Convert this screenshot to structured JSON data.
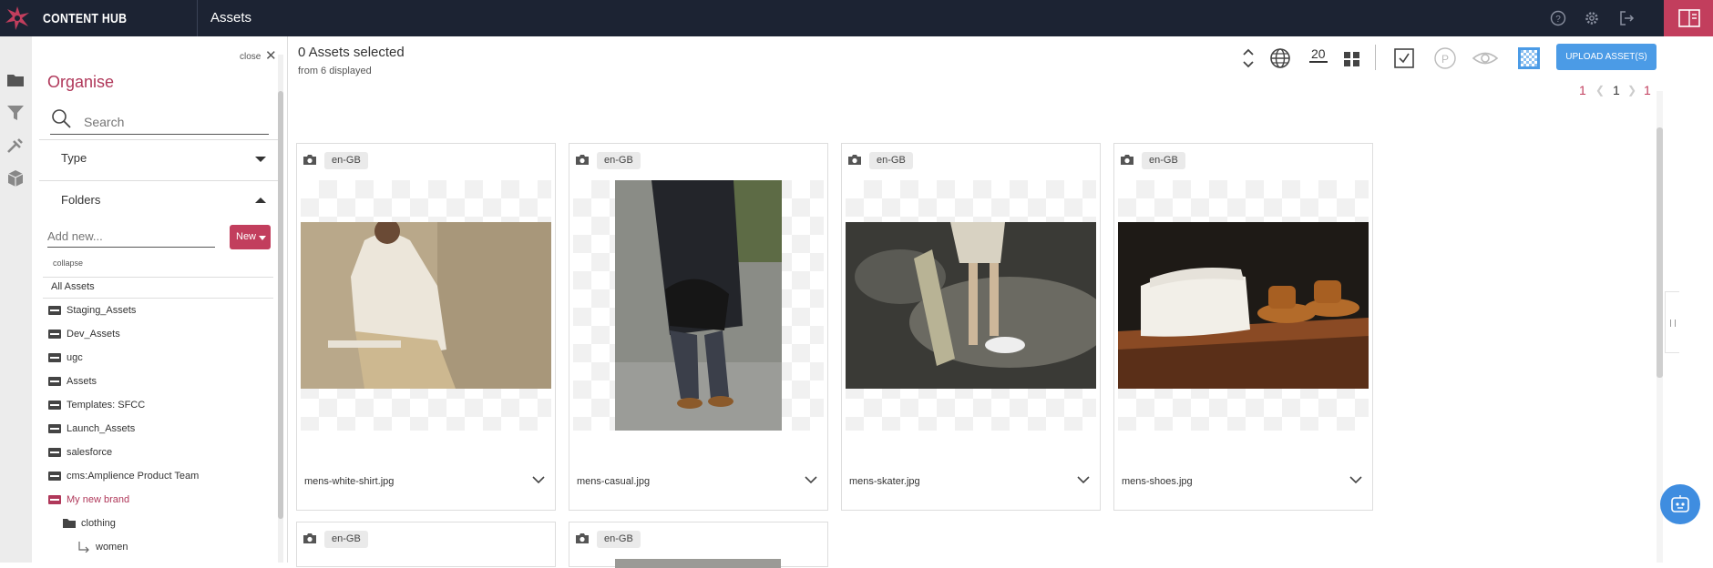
{
  "header": {
    "brand": "CONTENT HUB",
    "title": "Assets",
    "icons": [
      "help-icon",
      "settings-icon",
      "logout-icon",
      "panel-toggle-icon"
    ],
    "accent_color": "#c23e5d",
    "bg_color": "#1c2333"
  },
  "rail": {
    "icons": [
      "folder-icon",
      "filter-icon",
      "tools-icon",
      "package-icon"
    ]
  },
  "organise": {
    "close_label": "close",
    "title": "Organise",
    "search_placeholder": "Search",
    "type_label": "Type",
    "folders_label": "Folders",
    "add_new_placeholder": "Add new...",
    "new_button": "New",
    "collapse_label": "collapse",
    "all_assets": "All Assets",
    "folders": [
      {
        "label": "Staging_Assets",
        "active": false
      },
      {
        "label": "Dev_Assets",
        "active": false
      },
      {
        "label": "ugc",
        "active": false
      },
      {
        "label": "Assets",
        "active": false
      },
      {
        "label": "Templates: SFCC",
        "active": false
      },
      {
        "label": "Launch_Assets",
        "active": false
      },
      {
        "label": "salesforce",
        "active": false
      },
      {
        "label": "cms:Amplience Product Team",
        "active": false
      },
      {
        "label": "My new brand",
        "active": true
      },
      {
        "label": "clothing",
        "active": false
      },
      {
        "label": "women",
        "active": false
      }
    ]
  },
  "main": {
    "selected_title": "0 Assets selected",
    "selected_sub": "from 6 displayed",
    "page_size": "20",
    "upload_button": "UPLOAD ASSET(S)",
    "pager": {
      "first": "1",
      "current": "1",
      "last": "1"
    },
    "cards": [
      {
        "locale": "en-GB",
        "filename": "mens-white-shirt.jpg"
      },
      {
        "locale": "en-GB",
        "filename": "mens-casual.jpg"
      },
      {
        "locale": "en-GB",
        "filename": "mens-skater.jpg"
      },
      {
        "locale": "en-GB",
        "filename": "mens-shoes.jpg"
      },
      {
        "locale": "en-GB",
        "filename": ""
      },
      {
        "locale": "en-GB",
        "filename": ""
      }
    ]
  }
}
